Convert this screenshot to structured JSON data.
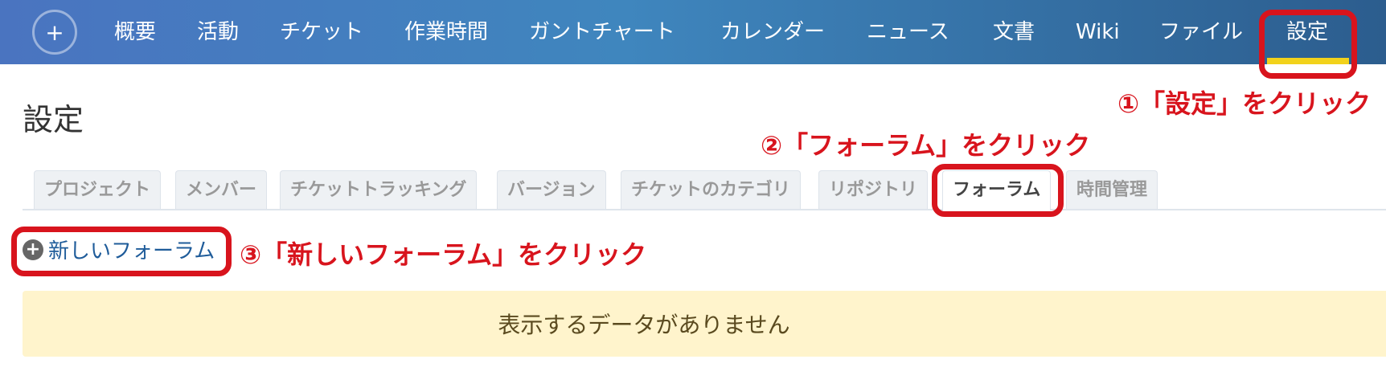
{
  "nav": {
    "plus": "+",
    "items": [
      "概要",
      "活動",
      "チケット",
      "作業時間",
      "ガントチャート",
      "カレンダー",
      "ニュース",
      "文書",
      "Wiki",
      "ファイル",
      "設定"
    ]
  },
  "page": {
    "title": "設定"
  },
  "tabs": [
    "プロジェクト",
    "メンバー",
    "チケットトラッキング",
    "バージョン",
    "チケットのカテゴリ",
    "リポジトリ",
    "フォーラム",
    "時間管理"
  ],
  "actions": {
    "new_forum": "新しいフォーラム",
    "plus_icon": "+"
  },
  "message": {
    "no_data": "表示するデータがありません"
  },
  "annotations": {
    "step1": "①「設定」をクリック",
    "step2": "②「フォーラム」をクリック",
    "step3": "③「新しいフォーラム」をクリック"
  },
  "colors": {
    "annotation": "#d8141d",
    "active_underline": "#f2d21b",
    "nodata_bg": "#fff4cc",
    "link": "#1f5c9a"
  }
}
